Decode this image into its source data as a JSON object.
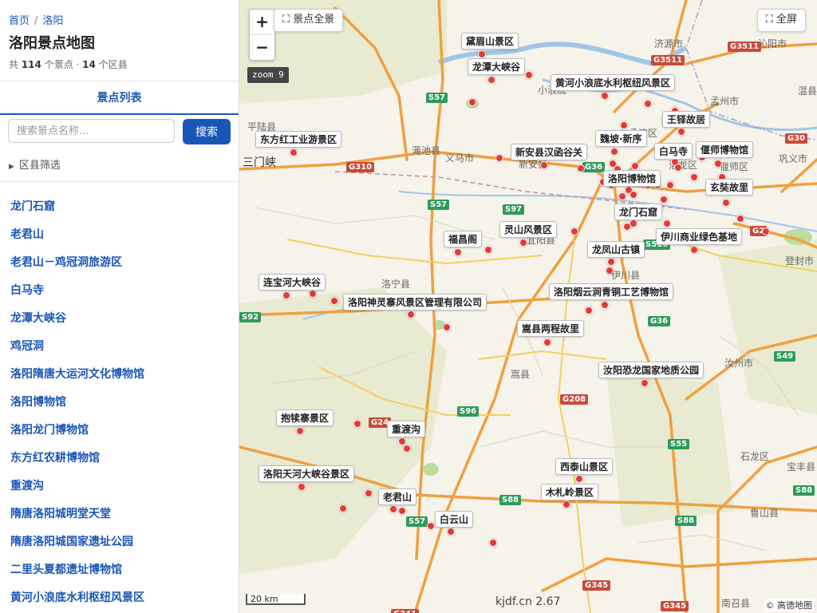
{
  "sidebar": {
    "breadcrumb": {
      "home": "首页",
      "separator": "/",
      "current": "洛阳"
    },
    "title": "洛阳景点地图",
    "stats": {
      "prefix": "共 ",
      "spots": "114",
      "mid": " 个景点 · ",
      "counties": "14",
      "suffix": " 个区县"
    },
    "tab_label": "景点列表",
    "search": {
      "placeholder": "搜索景点名称…",
      "value": "",
      "button": "搜索"
    },
    "filter_label": "区县筛选",
    "spot_list": [
      "龙门石窟",
      "老君山",
      "老君山－鸡冠洞旅游区",
      "白马寺",
      "龙潭大峡谷",
      "鸡冠洞",
      "洛阳隋唐大运河文化博物馆",
      "洛阳博物馆",
      "洛阳龙门博物馆",
      "东方红农耕博物馆",
      "重渡沟",
      "隋唐洛阳城明堂天堂",
      "隋唐洛阳城国家遗址公园",
      "二里头夏都遗址博物馆",
      "黄河小浪底水利枢纽风景区"
    ]
  },
  "map": {
    "zoom_in": "+",
    "zoom_out": "−",
    "overview_button": "⛶ 景点全景",
    "fullscreen_button": "⛶ 全屏",
    "zoom_level": "zoom 9",
    "scale": "20 km",
    "version": "kjdf.cn 2.67",
    "attribution": "© 高德地图",
    "colors": {
      "marker": "#e53935",
      "accent": "#1a56b8",
      "expressway": "#f0a040",
      "river": "#9fc6e8"
    },
    "labels": [
      "黛眉山景区",
      "龙潭大峡谷",
      "黄河小浪底水利枢纽风景区",
      "王铎故居",
      "魏坡·新序",
      "白马寺",
      "偃师博物馆",
      "东方红工业游景区",
      "新安县汉函谷关",
      "洛阳博物馆",
      "玄奘故里",
      "龙门石窟",
      "灵山风景区",
      "福昌阁",
      "伊川商业绿色基地",
      "龙凤山古镇",
      "连宝河大峡谷",
      "洛阳神灵寨风景区管理有限公司",
      "洛阳烟云涧青铜工艺博物馆",
      "嵩县两程故里",
      "汝阳恐龙国家地质公园",
      "抱犊寨景区",
      "重渡沟",
      "西泰山景区",
      "洛阳天河大峡谷景区",
      "木札岭景区",
      "老君山",
      "白云山"
    ],
    "towns": [
      "济源市",
      "沁阳市",
      "温县",
      "孟州市",
      "巩义市",
      "登封市",
      "汝州市",
      "宝丰县",
      "石龙区",
      "鲁山县",
      "南召县",
      "平陆县",
      "三门峡",
      "渑池县",
      "义马市",
      "新安县",
      "宜阳县",
      "洛宁县",
      "嵩县",
      "伊川县",
      "偃师区",
      "孟津区",
      "小浪底",
      "洛龙区"
    ],
    "shields": [
      "G3511",
      "G3511",
      "G30",
      "G310",
      "G36",
      "S57",
      "S57",
      "S97",
      "S516",
      "S92",
      "G36",
      "S49",
      "G24",
      "S96",
      "G208",
      "S55",
      "S88",
      "S88",
      "S57",
      "S88",
      "G345",
      "G345",
      "G241",
      "G2"
    ]
  }
}
